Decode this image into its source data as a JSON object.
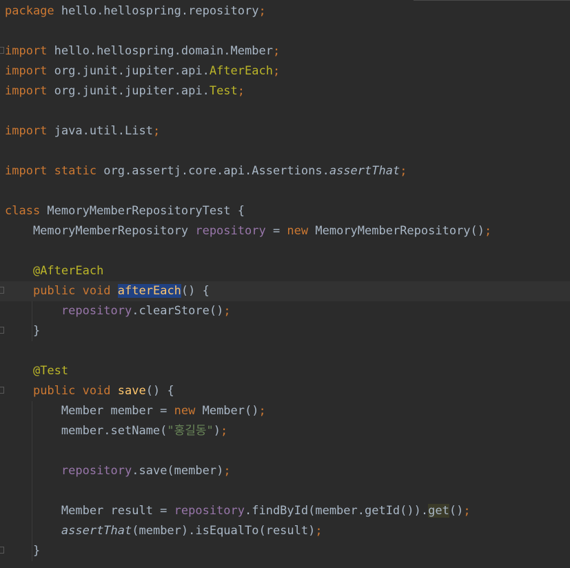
{
  "editor": {
    "language": "java",
    "lines": [
      [
        {
          "t": "package",
          "c": "kw"
        },
        {
          "t": " hello.hellospring.repository",
          "c": "pl"
        },
        {
          "t": ";",
          "c": "semi"
        }
      ],
      [],
      [
        {
          "t": "import",
          "c": "kw"
        },
        {
          "t": " hello.hellospring.domain.Member",
          "c": "pl"
        },
        {
          "t": ";",
          "c": "semi"
        }
      ],
      [
        {
          "t": "import",
          "c": "kw"
        },
        {
          "t": " org.junit.jupiter.api.",
          "c": "pl"
        },
        {
          "t": "AfterEach",
          "c": "ann"
        },
        {
          "t": ";",
          "c": "semi"
        }
      ],
      [
        {
          "t": "import",
          "c": "kw"
        },
        {
          "t": " org.junit.jupiter.api.",
          "c": "pl"
        },
        {
          "t": "Test",
          "c": "ann"
        },
        {
          "t": ";",
          "c": "semi"
        }
      ],
      [],
      [
        {
          "t": "import",
          "c": "kw"
        },
        {
          "t": " java.util.List",
          "c": "pl"
        },
        {
          "t": ";",
          "c": "semi"
        }
      ],
      [],
      [
        {
          "t": "import static",
          "c": "kw"
        },
        {
          "t": " org.assertj.core.api.Assertions.",
          "c": "pl"
        },
        {
          "t": "assertThat",
          "c": "ital"
        },
        {
          "t": ";",
          "c": "semi"
        }
      ],
      [],
      [
        {
          "t": "class",
          "c": "kw"
        },
        {
          "t": " MemoryMemberRepositoryTest {",
          "c": "pl"
        }
      ],
      [
        {
          "t": "    MemoryMemberRepository ",
          "c": "pl"
        },
        {
          "t": "repository",
          "c": "fld"
        },
        {
          "t": " = ",
          "c": "pl"
        },
        {
          "t": "new",
          "c": "kw"
        },
        {
          "t": " MemoryMemberRepository()",
          "c": "pl"
        },
        {
          "t": ";",
          "c": "semi"
        }
      ],
      [],
      [
        {
          "t": "    ",
          "c": "pl"
        },
        {
          "t": "@AfterEach",
          "c": "ann"
        }
      ],
      [
        {
          "t": "    ",
          "c": "pl"
        },
        {
          "t": "public void",
          "c": "kw"
        },
        {
          "t": " ",
          "c": "pl"
        },
        {
          "t": "afterEach",
          "c": "mth sel"
        },
        {
          "t": "() {",
          "c": "pl"
        }
      ],
      [
        {
          "t": "        ",
          "c": "pl"
        },
        {
          "t": "repository",
          "c": "fld"
        },
        {
          "t": ".clearStore()",
          "c": "pl"
        },
        {
          "t": ";",
          "c": "semi"
        }
      ],
      [
        {
          "t": "    }",
          "c": "pl"
        }
      ],
      [],
      [
        {
          "t": "    ",
          "c": "pl"
        },
        {
          "t": "@Test",
          "c": "ann"
        }
      ],
      [
        {
          "t": "    ",
          "c": "pl"
        },
        {
          "t": "public void",
          "c": "kw"
        },
        {
          "t": " ",
          "c": "pl"
        },
        {
          "t": "save",
          "c": "mth"
        },
        {
          "t": "() {",
          "c": "pl"
        }
      ],
      [
        {
          "t": "        Member member = ",
          "c": "pl"
        },
        {
          "t": "new",
          "c": "kw"
        },
        {
          "t": " Member()",
          "c": "pl"
        },
        {
          "t": ";",
          "c": "semi"
        }
      ],
      [
        {
          "t": "        member.setName(",
          "c": "pl"
        },
        {
          "t": "\"홍길동\"",
          "c": "str"
        },
        {
          "t": ")",
          "c": "pl"
        },
        {
          "t": ";",
          "c": "semi"
        }
      ],
      [],
      [
        {
          "t": "        ",
          "c": "pl"
        },
        {
          "t": "repository",
          "c": "fld"
        },
        {
          "t": ".save(member)",
          "c": "pl"
        },
        {
          "t": ";",
          "c": "semi"
        }
      ],
      [],
      [
        {
          "t": "        Member result = ",
          "c": "pl"
        },
        {
          "t": "repository",
          "c": "fld"
        },
        {
          "t": ".findById(member.getId()).",
          "c": "pl"
        },
        {
          "t": "get",
          "c": "pl hl"
        },
        {
          "t": "()",
          "c": "pl"
        },
        {
          "t": ";",
          "c": "semi"
        }
      ],
      [
        {
          "t": "        ",
          "c": "pl"
        },
        {
          "t": "assertThat",
          "c": "ital"
        },
        {
          "t": "(member).isEqualTo(result)",
          "c": "pl"
        },
        {
          "t": ";",
          "c": "semi"
        }
      ],
      [
        {
          "t": "    }",
          "c": "pl"
        }
      ]
    ],
    "current_line": 15,
    "fold_markers": [
      3,
      15,
      17,
      20,
      28
    ]
  }
}
